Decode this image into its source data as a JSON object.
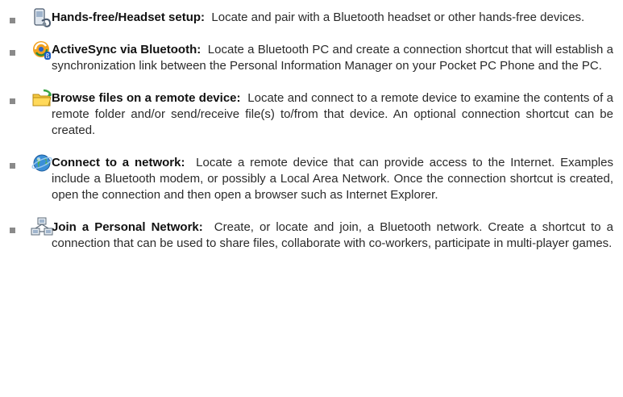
{
  "items": [
    {
      "icon": "headset-phone-icon",
      "title": "Hands-free/Headset setup:",
      "description": "Locate and pair with a Bluetooth headset or other hands-free devices."
    },
    {
      "icon": "activesync-icon",
      "title": "ActiveSync via Bluetooth:",
      "description": "Locate a Bluetooth PC and create a connection shortcut that will establish a synchronization link between the Personal Information Manager on your Pocket PC Phone and the PC."
    },
    {
      "icon": "folder-browse-icon",
      "title": "Browse files on a remote device:",
      "description": "Locate and connect to a remote device to examine the contents of a remote folder and/or send/receive file(s) to/from that device.  An optional connection shortcut can be created."
    },
    {
      "icon": "globe-network-icon",
      "title": "Connect to a network:",
      "description": "Locate a remote device that can provide access to the Internet.  Examples include a Bluetooth modem, or possibly a Local Area Network.  Once the connection shortcut is created, open the connection and then open a browser such as Internet Explorer."
    },
    {
      "icon": "personal-network-icon",
      "title": "Join a Personal Network:",
      "description": "Create, or locate and join, a Bluetooth network.  Create a shortcut to a connection that can be used to share files, collaborate with co-workers, participate in multi-player games."
    }
  ]
}
